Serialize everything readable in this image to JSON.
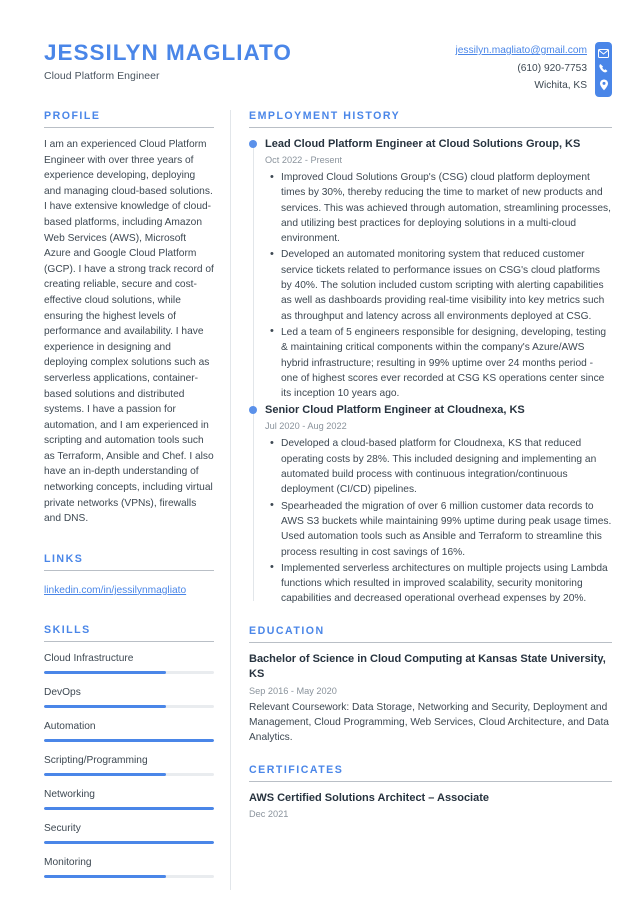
{
  "accent_color": "#4a86e8",
  "text_color": "#3d4852",
  "muted_color": "#8a939c",
  "header": {
    "full_name": "JESSILYN MAGLIATO",
    "job_title": "Cloud Platform Engineer",
    "email": "jessilyn.magliato@gmail.com",
    "phone": "(610) 920-7753",
    "location": "Wichita, KS",
    "icons": [
      "envelope-icon",
      "phone-icon",
      "location-pin-icon"
    ]
  },
  "profile": {
    "title": "PROFILE",
    "text": "I am an experienced Cloud Platform Engineer with over three years of experience developing, deploying and managing cloud-based solutions. I have extensive knowledge of cloud-based platforms, including Amazon Web Services (AWS), Microsoft Azure and Google Cloud Platform (GCP). I have a strong track record of creating reliable, secure and cost-effective cloud solutions, while ensuring the highest levels of performance and availability. I have experience in designing and deploying complex solutions such as serverless applications, container-based solutions and distributed systems. I have a passion for automation, and I am experienced in scripting and automation tools such as Terraform, Ansible and Chef. I also have an in-depth understanding of networking concepts, including virtual private networks (VPNs), firewalls and DNS."
  },
  "links": {
    "title": "LINKS",
    "items": [
      {
        "label": "linkedin.com/in/jessilynmagliato"
      }
    ]
  },
  "skills": {
    "title": "SKILLS",
    "items": [
      {
        "name": "Cloud Infrastructure",
        "level": 72
      },
      {
        "name": "DevOps",
        "level": 72
      },
      {
        "name": "Automation",
        "level": 100
      },
      {
        "name": "Scripting/Programming",
        "level": 72
      },
      {
        "name": "Networking",
        "level": 100
      },
      {
        "name": "Security",
        "level": 100
      },
      {
        "name": "Monitoring",
        "level": 72
      }
    ]
  },
  "employment": {
    "title": "EMPLOYMENT HISTORY",
    "jobs": [
      {
        "heading": "Lead Cloud Platform Engineer at Cloud Solutions Group, KS",
        "dates": "Oct 2022 - Present",
        "bullets": [
          "Improved Cloud Solutions Group's (CSG) cloud platform deployment times by 30%, thereby reducing the time to market of new products and services. This was achieved through automation, streamlining processes, and utilizing best practices for deploying solutions in a multi-cloud environment.",
          "Developed an automated monitoring system that reduced customer service tickets related to performance issues on CSG's cloud platforms by 40%. The solution included custom scripting with alerting capabilities as well as dashboards providing real-time visibility into key metrics such as throughput and latency across all environments deployed at CSG.",
          "Led a team of 5 engineers responsible for designing, developing, testing & maintaining critical components within the company's Azure/AWS hybrid infrastructure; resulting in 99% uptime over 24 months period - one of highest scores ever recorded at CSG KS operations center since its inception 10 years ago."
        ]
      },
      {
        "heading": "Senior Cloud Platform Engineer at Cloudnexa, KS",
        "dates": "Jul 2020 - Aug 2022",
        "bullets": [
          "Developed a cloud-based platform for Cloudnexa, KS that reduced operating costs by 28%. This included designing and implementing an automated build process with continuous integration/continuous deployment (CI/CD) pipelines.",
          "Spearheaded the migration of over 6 million customer data records to AWS S3 buckets while maintaining 99% uptime during peak usage times. Used automation tools such as Ansible and Terraform to streamline this process resulting in cost savings of 16%.",
          "Implemented serverless architectures on multiple projects using Lambda functions which resulted in improved scalability, security monitoring capabilities and decreased operational overhead expenses by 20%."
        ]
      }
    ]
  },
  "education": {
    "title": "EDUCATION",
    "entries": [
      {
        "heading": "Bachelor of Science in Cloud Computing at Kansas State University, KS",
        "dates": "Sep 2016 - May 2020",
        "description": "Relevant Coursework: Data Storage, Networking and Security, Deployment and Management, Cloud Programming, Web Services, Cloud Architecture, and Data Analytics."
      }
    ]
  },
  "certificates": {
    "title": "CERTIFICATES",
    "entries": [
      {
        "heading": "AWS Certified Solutions Architect – Associate",
        "dates": "Dec 2021"
      }
    ]
  }
}
